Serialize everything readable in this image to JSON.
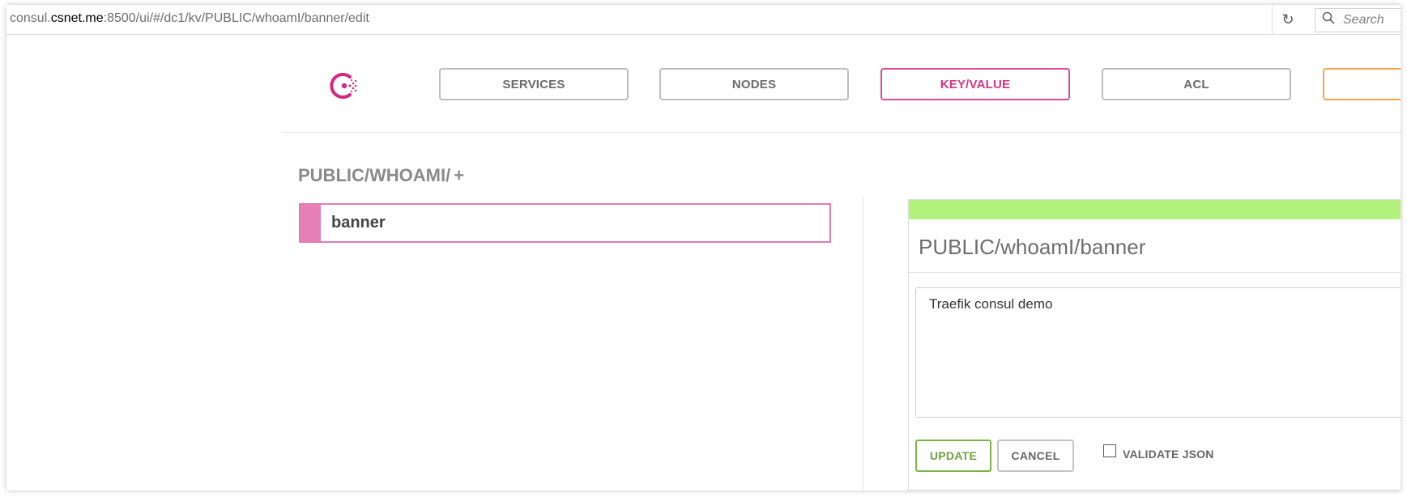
{
  "browser": {
    "url_prefix": "consul.",
    "url_host": "csnet.me",
    "url_rest": ":8500/ui/#/dc1/kv/PUBLIC/whoamI/banner/edit",
    "search_placeholder": "Search"
  },
  "nav": {
    "services": "SERVICES",
    "nodes": "NODES",
    "keyvalue": "KEY/VALUE",
    "acl": "ACL"
  },
  "kv": {
    "path": "PUBLIC/WHOAMI/",
    "plus": "+",
    "keys": [
      "banner"
    ]
  },
  "editor": {
    "title": "PUBLIC/whoamI/banner",
    "value": "Traefik consul demo",
    "update_label": "UPDATE",
    "cancel_label": "CANCEL",
    "validate_label": "VALIDATE JSON",
    "validate_checked": false
  },
  "colors": {
    "accent_pink": "#dd4a98",
    "success_green": "#b4f27e",
    "update_green": "#7cb348",
    "orange": "#f4a64d"
  }
}
